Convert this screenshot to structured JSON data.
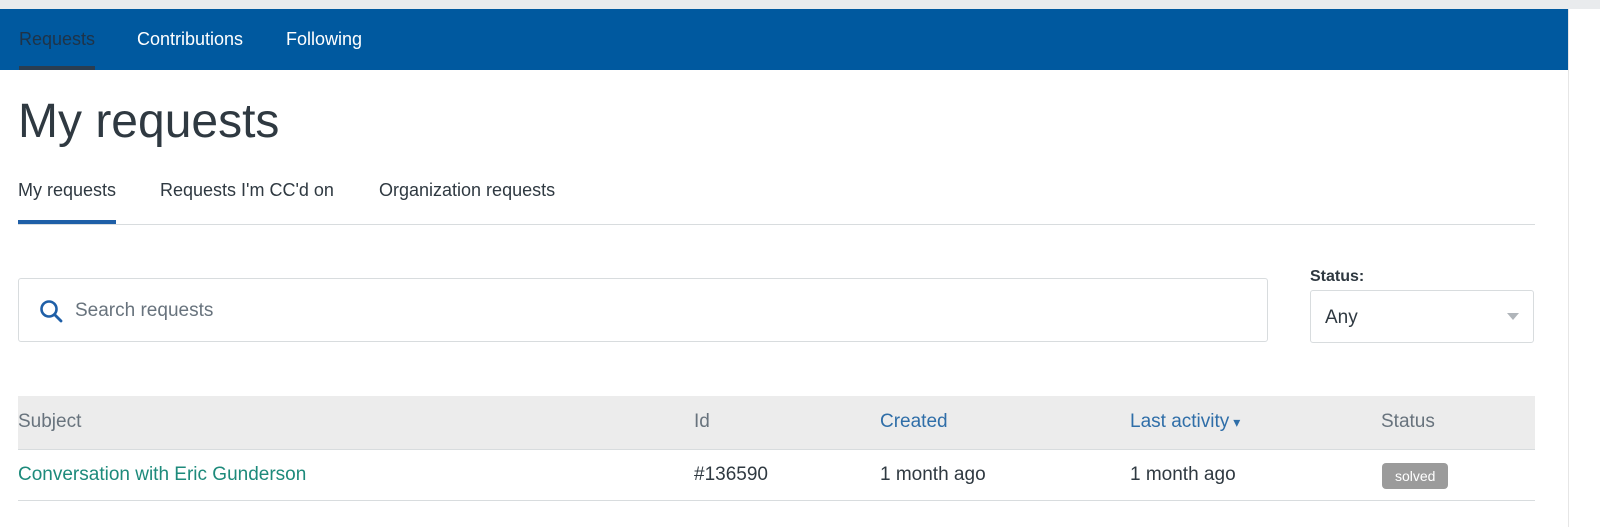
{
  "topnav": {
    "items": [
      {
        "label": "Requests",
        "active": true
      },
      {
        "label": "Contributions",
        "active": false
      },
      {
        "label": "Following",
        "active": false
      }
    ]
  },
  "page_title": "My requests",
  "tabs": [
    {
      "label": "My requests",
      "active": true
    },
    {
      "label": "Requests I'm CC'd on",
      "active": false
    },
    {
      "label": "Organization requests",
      "active": false
    }
  ],
  "search": {
    "placeholder": "Search requests",
    "value": "",
    "icon": "search-icon"
  },
  "status_filter": {
    "label": "Status:",
    "selected": "Any",
    "icon": "chevron-down-icon"
  },
  "table": {
    "columns": [
      {
        "label": "Subject",
        "sortable": false
      },
      {
        "label": "Id",
        "sortable": false
      },
      {
        "label": "Created",
        "sortable": true
      },
      {
        "label": "Last activity",
        "sortable": true,
        "sort_indicator": "▾"
      },
      {
        "label": "Status",
        "sortable": false
      }
    ],
    "rows": [
      {
        "subject": "Conversation with Eric Gunderson",
        "id": "#136590",
        "created": "1 month ago",
        "last_activity": "1 month ago",
        "status": "solved"
      }
    ]
  },
  "colors": {
    "nav_background": "#00599f",
    "link": "#1d8a7b",
    "sortable_header": "#2f6ea8",
    "tab_underline": "#1f5fa7",
    "status_badge_solved": "#9b9b9b"
  }
}
